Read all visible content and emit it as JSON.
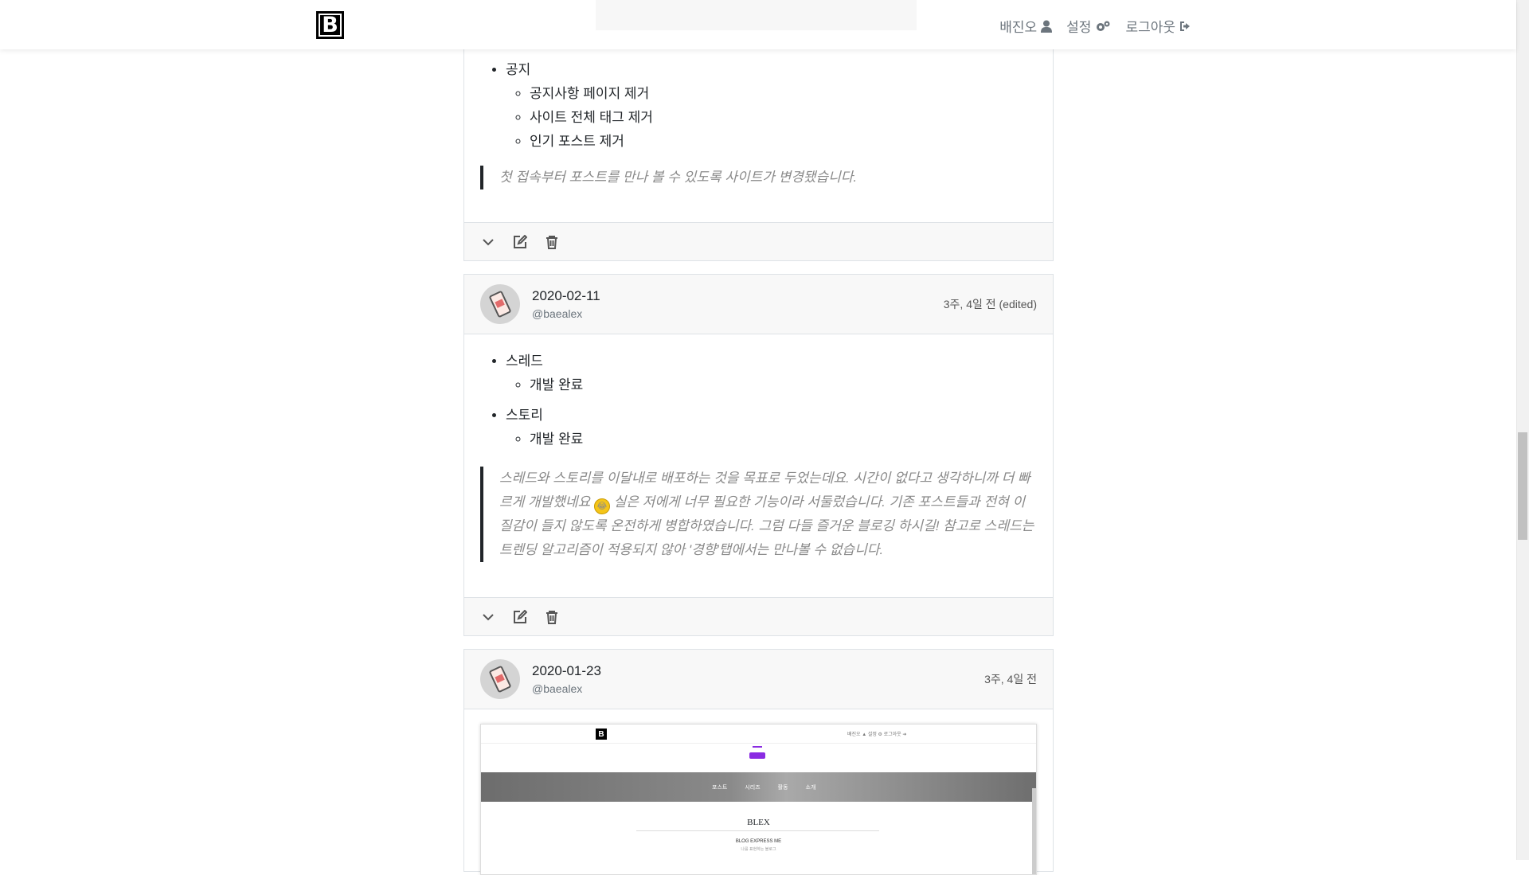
{
  "navbar": {
    "logo": "B",
    "links": [
      {
        "label": "배진오",
        "icon": "user-icon"
      },
      {
        "label": "설정",
        "icon": "gears-icon"
      },
      {
        "label": "로그아웃",
        "icon": "sign-out-icon"
      }
    ]
  },
  "posts": [
    {
      "body": {
        "list": [
          {
            "item": "공지",
            "subitems": [
              "공지사항 페이지 제거",
              "사이트 전체 태그 제거",
              "인기 포스트 제거"
            ]
          }
        ],
        "quote": "첫 접속부터 포스트를 만나 볼 수 있도록 사이트가 변경됐습니다."
      },
      "footer_icons": [
        "chevron-down-icon",
        "edit-icon",
        "trash-icon"
      ]
    },
    {
      "date": "2020-02-11",
      "user": "@baealex",
      "time": "3주, 4일 전 (edited)",
      "body": {
        "list": [
          {
            "item": "스레드",
            "subitems": [
              "개발 완료"
            ]
          },
          {
            "item": "스토리",
            "subitems": [
              "개발 완료"
            ]
          }
        ],
        "quote_part1": "스레드와 스토리를 이달내로 배포하는 것을 목표로 두었는데요. 시간이 없다고 생각하니까 더 빠르게 개발했네요",
        "quote_part2": "실은 저에게 너무 필요한 기능이라 서둘렀습니다. 기존 포스트들과 전혀 이질감이 들지 않도록 온전하게 병합하였습니다. 그럼 다들 즐거운 블로깅 하시길! 참고로 스레드는 트렌딩 알고리즘이 적용되지 않아 '경향'탭에서는 만나볼 수 없습니다."
      },
      "footer_icons": [
        "chevron-down-icon",
        "edit-icon",
        "trash-icon"
      ]
    },
    {
      "date": "2020-01-23",
      "user": "@baealex",
      "time": "3주, 4일 전",
      "screenshot": {
        "logo": "B",
        "nav": "배진오 ▲ 설정 ⚙ 로그아웃 ➜",
        "tabs": [
          "포스트",
          "시리즈",
          "활동",
          "소개"
        ],
        "title": "BLEX",
        "subtitle": "BLOG EXPRESS ME",
        "subtitle2": "나를 표현하는 블로그"
      }
    }
  ],
  "colors": {
    "header_bg": "#f8f8f8",
    "border": "#dee2e6",
    "quote_text": "#8a8a8a",
    "accent_purple": "#8a2be2"
  }
}
